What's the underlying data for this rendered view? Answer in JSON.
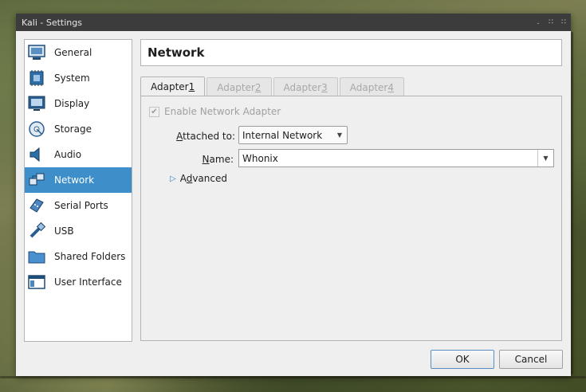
{
  "window": {
    "title": "Kali - Settings"
  },
  "sidebar": {
    "items": [
      {
        "label": "General",
        "icon": "monitor-icon",
        "active": false
      },
      {
        "label": "System",
        "icon": "chip-icon",
        "active": false
      },
      {
        "label": "Display",
        "icon": "display-icon",
        "active": false
      },
      {
        "label": "Storage",
        "icon": "disc-icon",
        "active": false
      },
      {
        "label": "Audio",
        "icon": "speaker-icon",
        "active": false
      },
      {
        "label": "Network",
        "icon": "network-icon",
        "active": true
      },
      {
        "label": "Serial Ports",
        "icon": "serial-port-icon",
        "active": false
      },
      {
        "label": "USB",
        "icon": "usb-icon",
        "active": false
      },
      {
        "label": "Shared Folders",
        "icon": "folder-icon",
        "active": false
      },
      {
        "label": "User Interface",
        "icon": "window-icon",
        "active": false
      }
    ]
  },
  "header": {
    "title": "Network"
  },
  "tabs": [
    {
      "prefix": "Adapter ",
      "accel": "1",
      "active": true
    },
    {
      "prefix": "Adapter ",
      "accel": "2",
      "active": false
    },
    {
      "prefix": "Adapter ",
      "accel": "3",
      "active": false
    },
    {
      "prefix": "Adapter ",
      "accel": "4",
      "active": false
    }
  ],
  "adapter": {
    "enable_label": "Enable Network Adapter",
    "enable_checked": true,
    "attached_label_accel": "A",
    "attached_label_rest": "ttached to:",
    "attached_value": "Internal Network",
    "name_label_accel": "N",
    "name_label_rest": "ame:",
    "name_value": "Whonix",
    "advanced_pre": "A",
    "advanced_accel": "d",
    "advanced_rest": "vanced"
  },
  "buttons": {
    "ok": "OK",
    "cancel": "Cancel"
  },
  "colors": {
    "accent": "#3d8ec9",
    "titlebar": "#3c3c3c"
  }
}
